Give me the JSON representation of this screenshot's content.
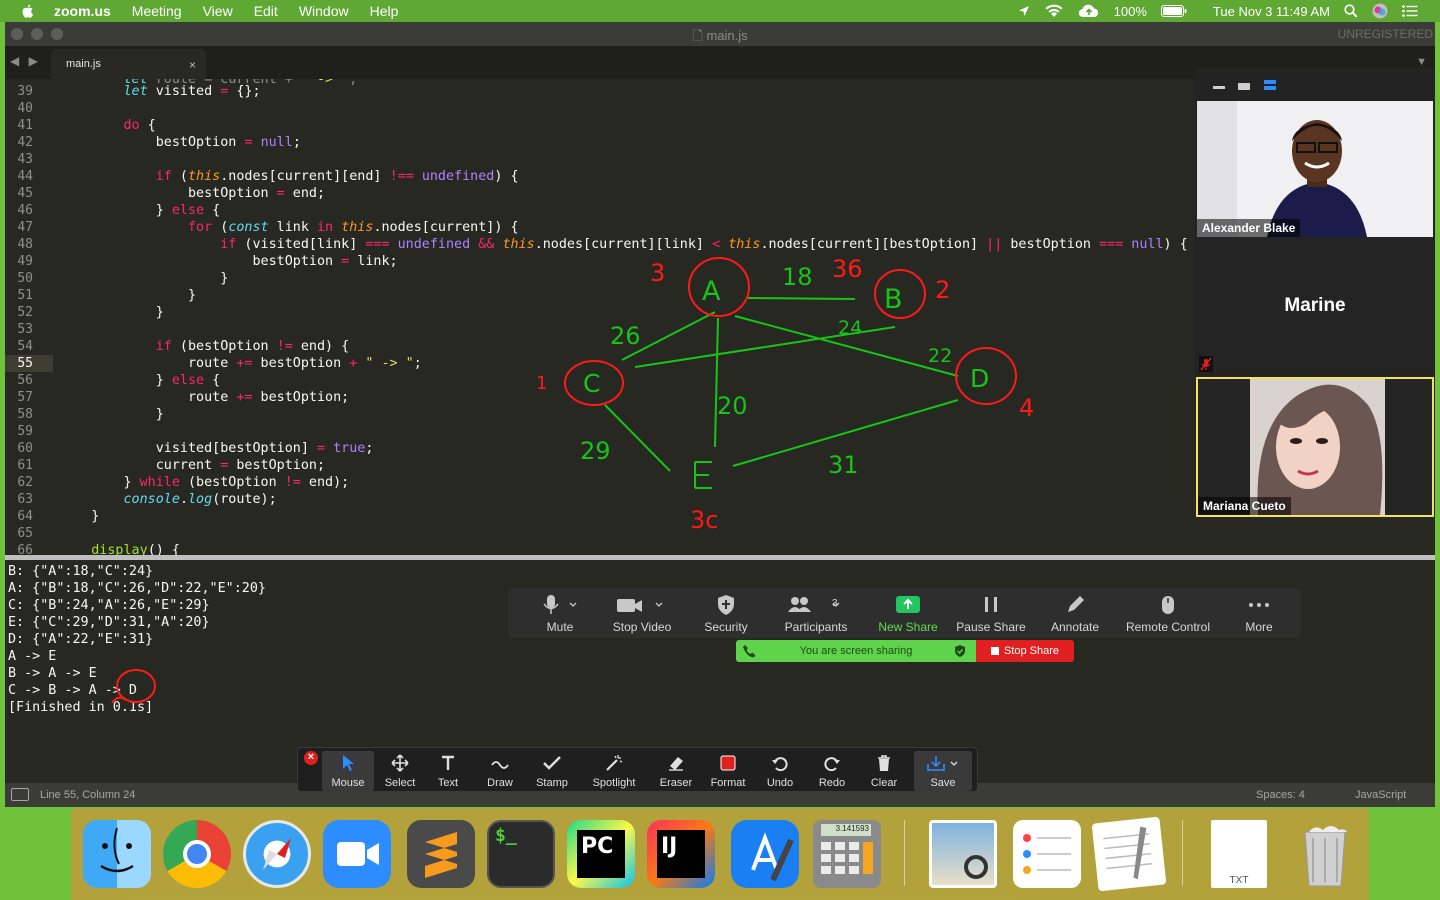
{
  "menubar": {
    "app": "zoom.us",
    "items": [
      "Meeting",
      "View",
      "Edit",
      "Window",
      "Help"
    ],
    "battery": "100%",
    "clock": "Tue Nov 3  11:49 AM"
  },
  "window": {
    "title": "main.js",
    "watermark": "UNREGISTERED",
    "tab": "main.js",
    "tab_close": "×"
  },
  "editor": {
    "lines": [
      {
        "n": "39"
      },
      {
        "n": "40"
      },
      {
        "n": "41"
      },
      {
        "n": "42"
      },
      {
        "n": "43"
      },
      {
        "n": "44"
      },
      {
        "n": "45"
      },
      {
        "n": "46"
      },
      {
        "n": "47"
      },
      {
        "n": "48"
      },
      {
        "n": "49"
      },
      {
        "n": "50"
      },
      {
        "n": "51"
      },
      {
        "n": "52"
      },
      {
        "n": "53"
      },
      {
        "n": "54"
      },
      {
        "n": "55"
      },
      {
        "n": "56"
      },
      {
        "n": "57"
      },
      {
        "n": "58"
      },
      {
        "n": "59"
      },
      {
        "n": "60"
      },
      {
        "n": "61"
      },
      {
        "n": "62"
      },
      {
        "n": "63"
      },
      {
        "n": "64"
      },
      {
        "n": "65"
      },
      {
        "n": "66"
      }
    ]
  },
  "console": {
    "lines": [
      "B: {\"A\":18,\"C\":24}",
      "A: {\"B\":18,\"C\":26,\"D\":22,\"E\":20}",
      "C: {\"B\":24,\"A\":26,\"E\":29}",
      "E: {\"C\":29,\"D\":31,\"A\":20}",
      "D: {\"A\":22,\"E\":31}",
      "A -> E",
      "B -> A -> E",
      "C -> B -> A -> D",
      "[Finished in 0.1s]"
    ]
  },
  "statusbar": {
    "position": "Line 55, Column 24",
    "spaces": "Spaces: 4",
    "language": "JavaScript"
  },
  "annotations": {
    "nodes": [
      "A",
      "B",
      "C",
      "D",
      "E"
    ],
    "weights": [
      "18",
      "36",
      "26",
      "24",
      "22",
      "20",
      "29",
      "31"
    ],
    "node_labels": [
      "3",
      "2",
      "1",
      "4",
      "3c"
    ]
  },
  "video": {
    "participants": [
      {
        "name": "Alexander Blake"
      },
      {
        "name": "Marine"
      },
      {
        "name": "Mariana Cueto"
      }
    ]
  },
  "meeting_controls": {
    "mute": "Mute",
    "stop_video": "Stop Video",
    "security": "Security",
    "participants": "Participants",
    "participant_count": "3",
    "new_share": "New Share",
    "pause_share": "Pause Share",
    "annotate": "Annotate",
    "remote_control": "Remote Control",
    "more": "More",
    "sharing_status": "You are screen sharing",
    "stop_share": "Stop Share"
  },
  "annotation_toolbar": {
    "tools": [
      "Mouse",
      "Select",
      "Text",
      "Draw",
      "Stamp",
      "Spotlight",
      "Eraser",
      "Format",
      "Undo",
      "Redo",
      "Clear",
      "Save"
    ],
    "active": "Mouse"
  },
  "dock": {
    "apps": [
      "Finder",
      "Google Chrome",
      "Safari",
      "Zoom",
      "Sublime Text",
      "Terminal",
      "PyCharm",
      "IntelliJ IDEA",
      "Xcode",
      "Calculator",
      "Preview",
      "Reminders",
      "TextEdit",
      "TXT Document",
      "Trash"
    ],
    "calculator_display": "3.141593",
    "txt_label": "TXT"
  },
  "colors": {
    "accent_green": "#6fc23a",
    "annotation_green": "#17c417",
    "annotation_red": "#ff1a1a",
    "share_green": "#5fd34b",
    "stop_red": "#e02020"
  }
}
